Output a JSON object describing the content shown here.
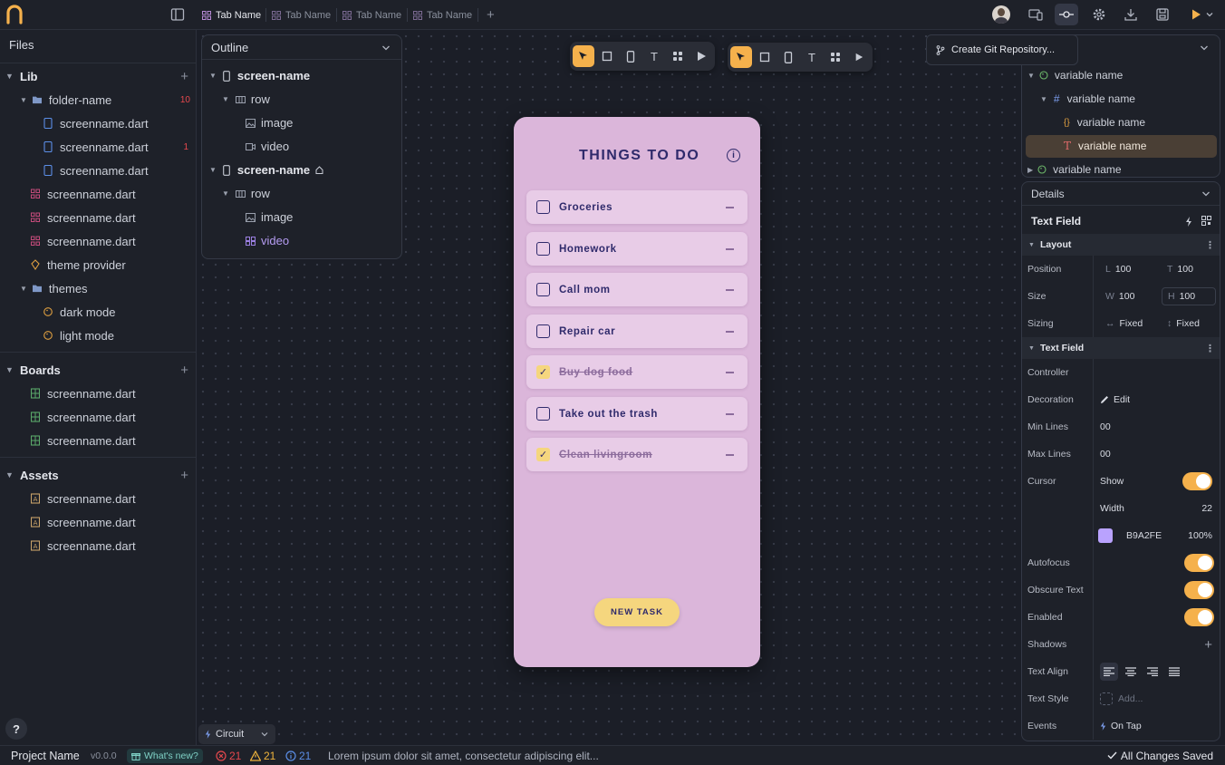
{
  "topbar": {
    "tabs": [
      "Tab Name",
      "Tab Name",
      "Tab Name",
      "Tab Name"
    ]
  },
  "sidebar": {
    "title": "Files",
    "lib": {
      "label": "Lib",
      "folder": "folder-name",
      "folder_badge": "10",
      "folder_files": [
        "screenname.dart",
        "screenname.dart",
        "screenname.dart"
      ],
      "folder_file_badge": "1",
      "files": [
        "screenname.dart",
        "screenname.dart",
        "screenname.dart"
      ],
      "theme_provider": "theme provider",
      "themes": "themes",
      "theme_items": [
        "dark mode",
        "light mode"
      ]
    },
    "boards": {
      "label": "Boards",
      "files": [
        "screenname.dart",
        "screenname.dart",
        "screenname.dart"
      ]
    },
    "assets": {
      "label": "Assets",
      "files": [
        "screenname.dart",
        "screenname.dart",
        "screenname.dart"
      ]
    }
  },
  "outline": {
    "title": "Outline",
    "items": [
      "screen-name",
      "row",
      "image",
      "video",
      "screen-name",
      "row",
      "image",
      "video"
    ]
  },
  "git": {
    "label": "Create Git Repository..."
  },
  "variables": {
    "items": [
      "variable name",
      "variable name",
      "variable name",
      "variable name",
      "variable name"
    ]
  },
  "phone": {
    "title": "THINGS TO DO",
    "tasks": [
      "Groceries",
      "Homework",
      "Call mom",
      "Repair car",
      "Buy dog food",
      "Take out the trash",
      "Clean livingroom"
    ],
    "button": "NEW TASK"
  },
  "details": {
    "title": "Details",
    "widget": "Text Field",
    "layout_section": "Layout",
    "position_label": "Position",
    "pos_l_prefix": "L",
    "pos_l": "100",
    "pos_t_prefix": "T",
    "pos_t": "100",
    "size_label": "Size",
    "size_w_prefix": "W",
    "size_w": "100",
    "size_h_prefix": "H",
    "size_h": "100",
    "sizing_label": "Sizing",
    "sizing_w": "Fixed",
    "sizing_h": "Fixed",
    "tf_section": "Text Field",
    "controller_label": "Controller",
    "decoration_label": "Decoration",
    "decoration_value": "Edit",
    "min_lines_label": "Min Lines",
    "min_lines": "00",
    "max_lines_label": "Max Lines",
    "max_lines": "00",
    "cursor_label": "Cursor",
    "cursor_show": "Show",
    "width_label": "Width",
    "width_value": "22",
    "color_hex": "B9A2FE",
    "color_opacity": "100%",
    "autofocus_label": "Autofocus",
    "obscure_label": "Obscure Text",
    "enabled_label": "Enabled",
    "shadows_label": "Shadows",
    "text_align_label": "Text Align",
    "text_style_label": "Text Style",
    "text_style_placeholder": "Add...",
    "events_label": "Events",
    "events_value": "On Tap"
  },
  "status": {
    "project": "Project Name",
    "version": "v0.0.0",
    "whats_new": "What's new?",
    "errors": "21",
    "warnings": "21",
    "infos": "21",
    "message": "Lorem ipsum dolor sit amet, consectetur adipiscing elit...",
    "saved": "All Changes Saved"
  },
  "circuit": {
    "label": "Circuit"
  },
  "help": {
    "label": "?"
  },
  "colors": {
    "accent": "#f5b14c",
    "phone_bg": "#dbb6da",
    "task_bg": "#e8cce7",
    "text_dark": "#2f2a6b",
    "error": "#e5484d",
    "cursor_color": "#b9a2fe"
  }
}
